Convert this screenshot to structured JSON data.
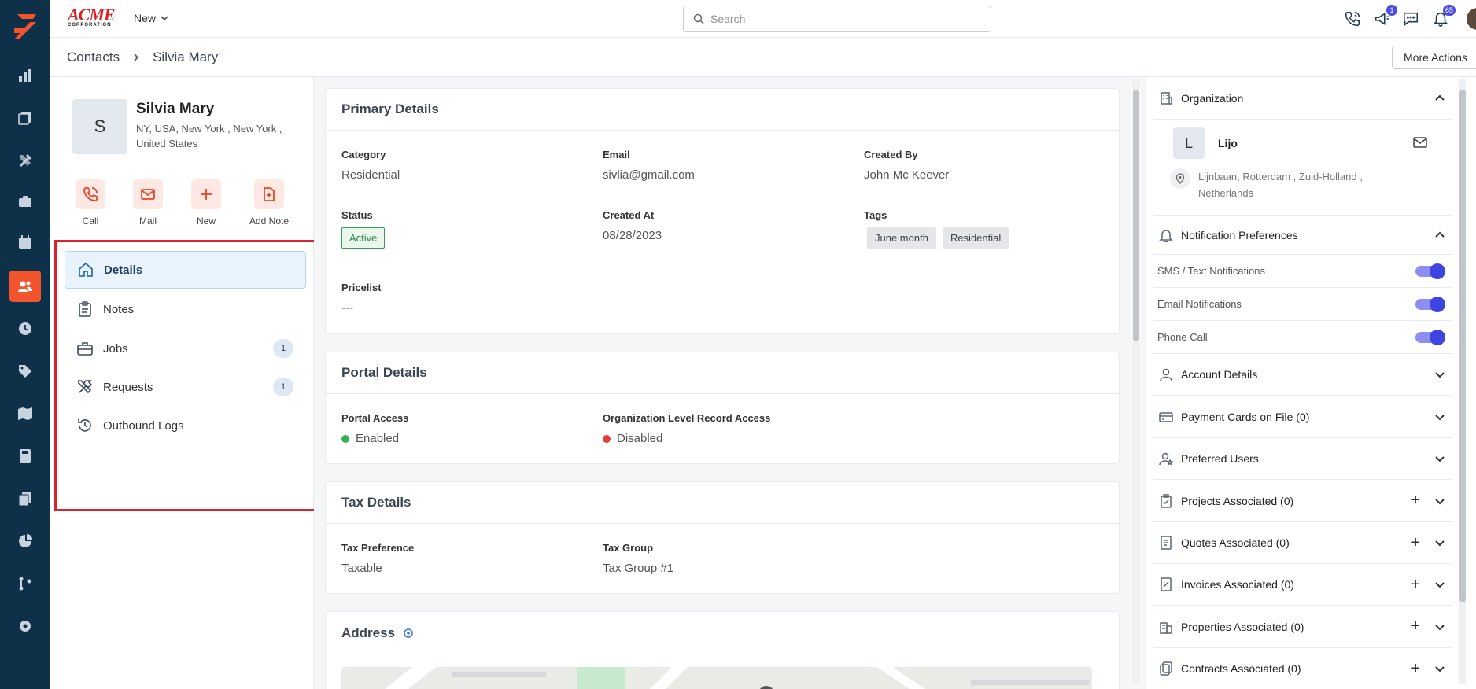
{
  "topbar": {
    "brand_name": "ACME",
    "brand_sub": "CORPORATION",
    "new_label": "New",
    "search_placeholder": "Search",
    "chat_badge": "1",
    "notif_badge": "65"
  },
  "breadcrumb": {
    "root": "Contacts",
    "current": "Silvia Mary"
  },
  "more_actions_label": "More Actions",
  "contact": {
    "initial": "S",
    "name": "Silvia Mary",
    "address": "NY, USA, New York , New York , United States"
  },
  "quick_actions": {
    "call": "Call",
    "mail": "Mail",
    "new": "New",
    "add_note": "Add Note"
  },
  "nav": {
    "details": "Details",
    "notes": "Notes",
    "jobs": "Jobs",
    "jobs_count": "1",
    "requests": "Requests",
    "requests_count": "1",
    "outbound_logs": "Outbound Logs"
  },
  "primary": {
    "title": "Primary Details",
    "category_label": "Category",
    "category_value": "Residential",
    "email_label": "Email",
    "email_value": "sivlia@gmail.com",
    "created_by_label": "Created By",
    "created_by_value": "John Mc Keever",
    "status_label": "Status",
    "status_value": "Active",
    "created_at_label": "Created At",
    "created_at_value": "08/28/2023",
    "tags_label": "Tags",
    "tags": [
      "June month",
      "Residential"
    ],
    "pricelist_label": "Pricelist",
    "pricelist_value": "---"
  },
  "portal": {
    "title": "Portal Details",
    "access_label": "Portal Access",
    "access_value": "Enabled",
    "org_access_label": "Organization Level Record Access",
    "org_access_value": "Disabled"
  },
  "tax": {
    "title": "Tax Details",
    "pref_label": "Tax Preference",
    "pref_value": "Taxable",
    "group_label": "Tax Group",
    "group_value": "Tax Group #1"
  },
  "address": {
    "title": "Address"
  },
  "organization": {
    "title": "Organization",
    "initial": "L",
    "name": "Lijo",
    "address": "Lijnbaan, Rotterdam , Zuid-Holland , Netherlands"
  },
  "notifications": {
    "title": "Notification Preferences",
    "sms": "SMS / Text Notifications",
    "email": "Email Notifications",
    "phone": "Phone Call",
    "sms_on": true,
    "email_on": true,
    "phone_on": true
  },
  "sections": {
    "account": "Account Details",
    "payment": "Payment Cards on File (0)",
    "preferred": "Preferred Users",
    "projects": "Projects Associated (0)",
    "quotes": "Quotes Associated (0)",
    "invoices": "Invoices Associated (0)",
    "properties": "Properties Associated (0)",
    "contracts": "Contracts Associated (0)"
  },
  "colors": {
    "accent": "#f2542d",
    "rail": "#0f3049",
    "highlight_border": "#d9232d",
    "toggle": "#3f43e0"
  }
}
